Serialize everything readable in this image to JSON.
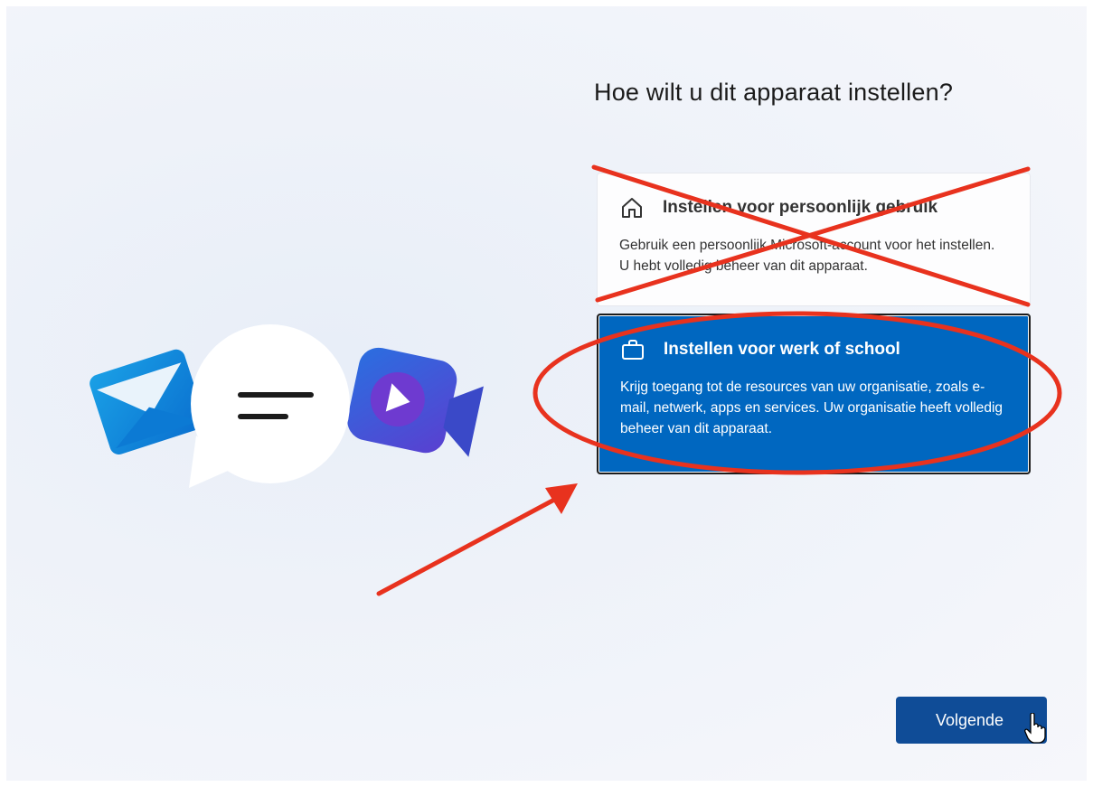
{
  "page": {
    "title": "Hoe wilt u dit apparaat instellen?"
  },
  "options": [
    {
      "title": "Instellen voor persoonlijk gebruik",
      "description": "Gebruik een persoonlijk Microsoft-account voor het instellen. U hebt volledig beheer van dit apparaat.",
      "icon": "home-icon",
      "selected": false,
      "annotation": "crossed-out"
    },
    {
      "title": "Instellen voor werk of school",
      "description": "Krijg toegang tot de resources van uw organisatie, zoals e-mail, netwerk, apps en services. Uw organisatie heeft volledig beheer van dit apparaat.",
      "icon": "briefcase-icon",
      "selected": true,
      "annotation": "circled"
    }
  ],
  "footer": {
    "next_label": "Volgende"
  },
  "colors": {
    "accent": "#0067c0",
    "button": "#0f4c97",
    "annotation_red": "#e8321e"
  },
  "illustration": {
    "icons": [
      "mail-icon",
      "chat-bubble-icon",
      "video-camera-icon"
    ]
  }
}
